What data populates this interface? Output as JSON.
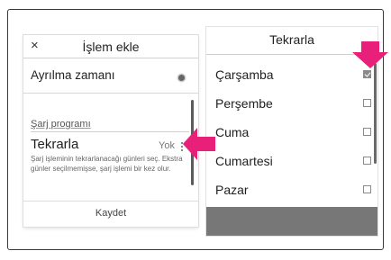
{
  "left_panel": {
    "close_glyph": "×",
    "title": "İşlem ekle",
    "departure_label": "Ayrılma zamanı",
    "section_label": "Şarj programı",
    "repeat_label": "Tekrarla",
    "repeat_value": "Yok",
    "repeat_description": "Şarj işleminin tekrarlanacağı günleri seç. Ekstra günler seçilmemişse, şarj işlemi bir kez olur.",
    "save_label": "Kaydet"
  },
  "right_panel": {
    "title": "Tekrarla",
    "days": [
      {
        "label": "Çarşamba",
        "checked": true
      },
      {
        "label": "Perşembe",
        "checked": false
      },
      {
        "label": "Cuma",
        "checked": false
      },
      {
        "label": "Cumartesi",
        "checked": false
      },
      {
        "label": "Pazar",
        "checked": false
      }
    ]
  },
  "colors": {
    "highlight_arrow": "#e8207a",
    "scrollbar": "#5c5c5c",
    "footer_bar": "#777777"
  },
  "icons": {
    "close": "close-icon",
    "radio": "radio-icon",
    "more": "more-vertical-icon",
    "checkbox": "checkbox-icon",
    "arrow": "arrow-icon"
  }
}
